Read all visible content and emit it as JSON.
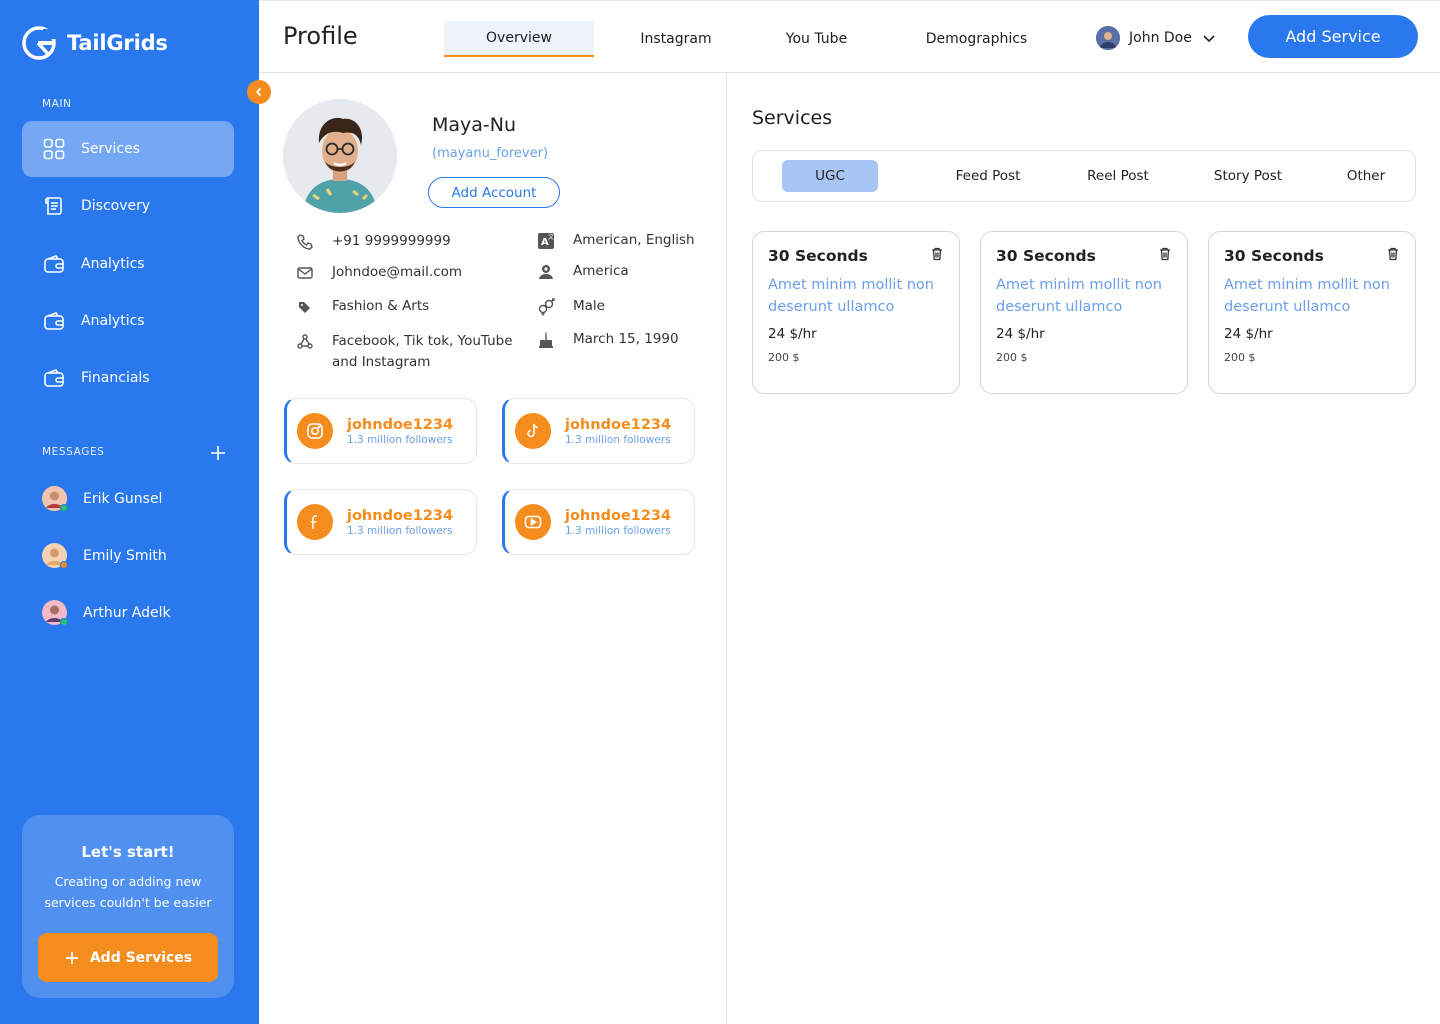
{
  "brand": {
    "name": "TailGrids"
  },
  "sidebar": {
    "main_label": "MAIN",
    "items": [
      {
        "label": "Services",
        "icon": "grid-icon",
        "active": true
      },
      {
        "label": "Discovery",
        "icon": "document-icon"
      },
      {
        "label": "Analytics",
        "icon": "wallet-icon"
      },
      {
        "label": "Analytics",
        "icon": "wallet-icon"
      },
      {
        "label": "Financials",
        "icon": "wallet-icon"
      }
    ],
    "messages_label": "MESSAGES",
    "messages": [
      {
        "name": "Erik Gunsel"
      },
      {
        "name": "Emily Smith"
      },
      {
        "name": "Arthur Adelk"
      }
    ],
    "cta": {
      "title": "Let's start!",
      "subtitle": "Creating or adding new services couldn't be easier",
      "button": "Add Services"
    }
  },
  "header": {
    "title": "Profile",
    "tabs": [
      "Overview",
      "Instagram",
      "You Tube",
      "Demographics"
    ],
    "active_tab": "Overview",
    "user": "John Doe",
    "add_button": "Add Service"
  },
  "profile": {
    "name": "Maya-Nu",
    "handle": "(mayanu_forever)",
    "add_account": "Add Account",
    "phone": "+91 9999999999",
    "email": "Johndoe@mail.com",
    "category": "Fashion & Arts",
    "platforms": "Facebook, Tik tok, YouTube and Instagram",
    "languages": "American, English",
    "location": "America",
    "gender": "Male",
    "birthday": "March 15, 1990",
    "socials": [
      {
        "platform": "instagram-icon",
        "handle": "johndoe1234",
        "followers": "1.3 million followers"
      },
      {
        "platform": "tiktok-icon",
        "handle": "johndoe1234",
        "followers": "1.3 million followers"
      },
      {
        "platform": "facebook-icon",
        "handle": "johndoe1234",
        "followers": "1.3 million followers"
      },
      {
        "platform": "youtube-icon",
        "handle": "johndoe1234",
        "followers": "1.3 million followers"
      }
    ]
  },
  "services": {
    "title": "Services",
    "categories": [
      "UGC",
      "Feed Post",
      "Reel Post",
      "Story Post",
      "Other"
    ],
    "active_category": "UGC",
    "cards": [
      {
        "title": "30 Seconds",
        "description": "Amet minim mollit non deserunt ullamco",
        "rate": "24 $/hr",
        "price": "200 $"
      },
      {
        "title": "30 Seconds",
        "description": "Amet minim mollit non deserunt ullamco",
        "rate": "24 $/hr",
        "price": "200 $"
      },
      {
        "title": "30 Seconds",
        "description": "Amet minim mollit non deserunt ullamco",
        "rate": "24 $/hr",
        "price": "200 $"
      }
    ]
  },
  "colors": {
    "primary": "#2a78ee",
    "accent": "#f48d1e",
    "link": "#6aa0e8"
  }
}
